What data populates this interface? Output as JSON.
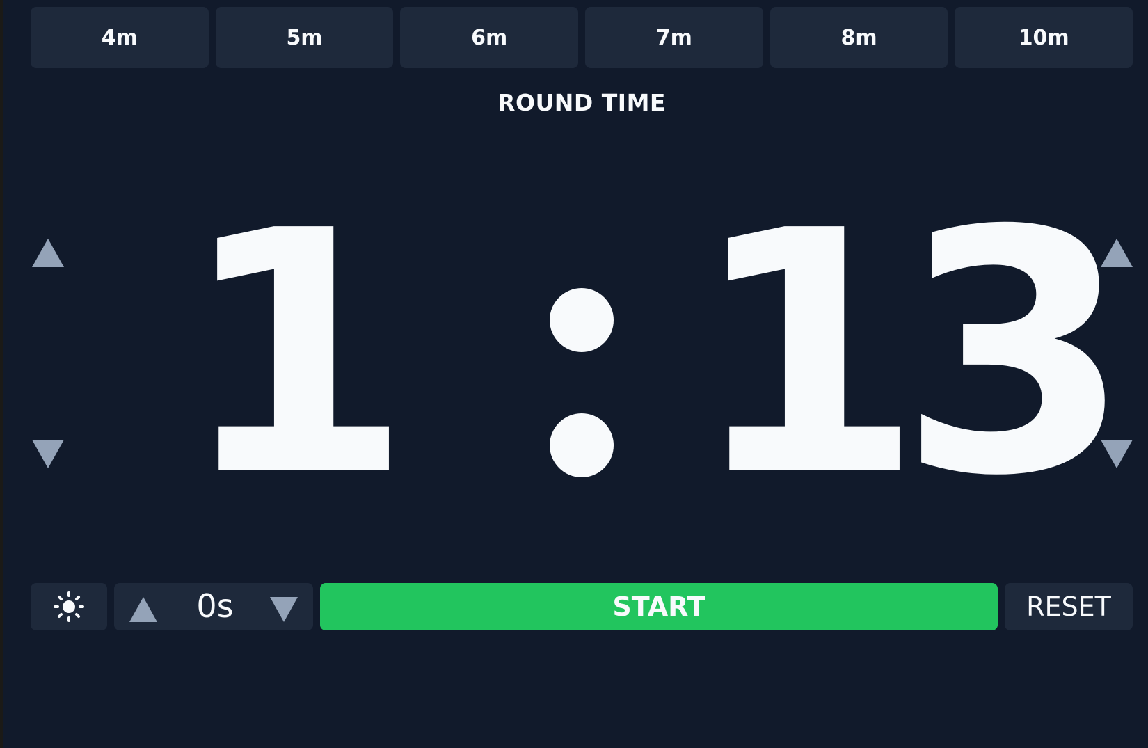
{
  "presets": [
    "4m",
    "5m",
    "6m",
    "7m",
    "8m",
    "10m"
  ],
  "label": "ROUND TIME",
  "timer": {
    "minutes": "1",
    "seconds_tens": "1",
    "seconds_ones": "3"
  },
  "controls": {
    "brightness_icon": "sun-icon",
    "delay_value": "0s",
    "start_label": "START",
    "reset_label": "RESET"
  },
  "colors": {
    "background": "#111a2b",
    "panel": "#1e293b",
    "arrow": "#94a3b8",
    "start": "#22c55e",
    "text": "#f8fafc"
  }
}
